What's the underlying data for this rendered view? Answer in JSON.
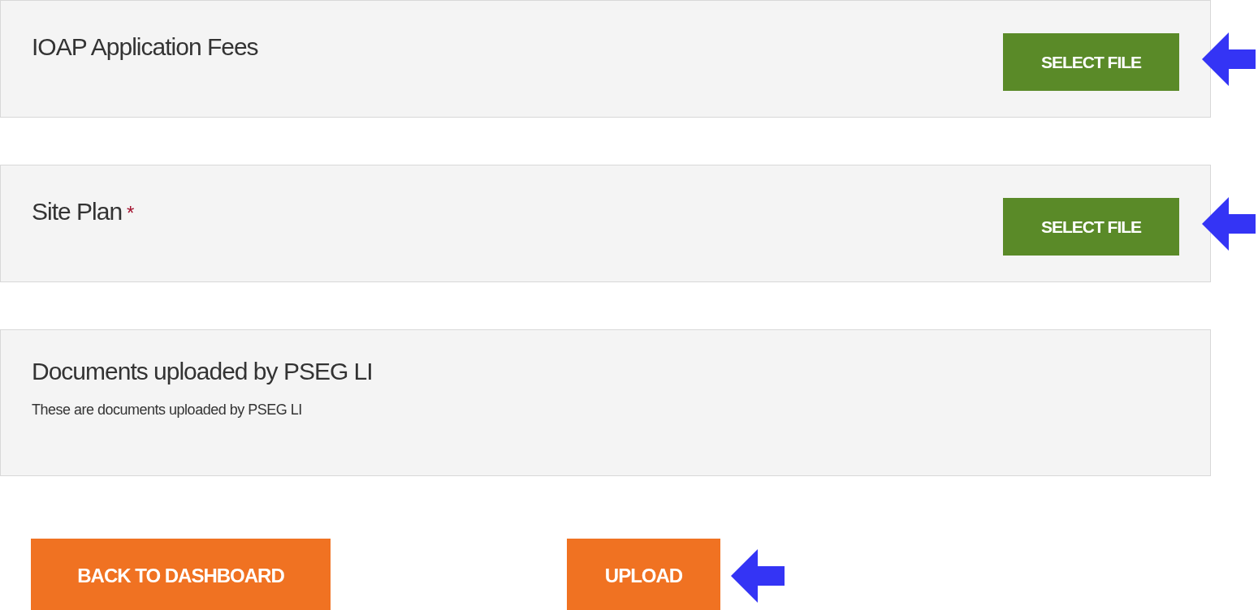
{
  "documents": [
    {
      "kind": "upload",
      "title": "IOAP Application Fees",
      "button": "SELECT FILE",
      "arrow": true
    },
    {
      "kind": "upload",
      "title": "Site Plan",
      "required_mark": "*",
      "button": "SELECT FILE",
      "arrow": true
    },
    {
      "kind": "info",
      "title": "Documents uploaded by PSEG LI",
      "description": "These are documents uploaded by PSEG LI"
    }
  ],
  "actions": [
    {
      "label": "BACK TO DASHBOARD",
      "arrow": false
    },
    {
      "label": "UPLOAD",
      "arrow": true
    }
  ]
}
